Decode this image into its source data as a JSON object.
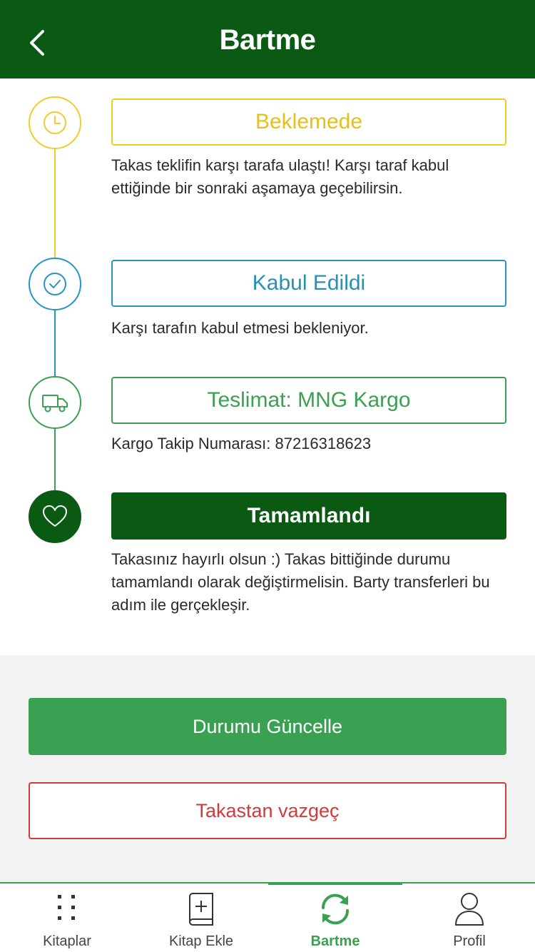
{
  "header": {
    "title": "Bartme"
  },
  "steps": [
    {
      "label": "Beklemede",
      "description": "Takas teklifin karşı tarafa ulaştı! Karşı taraf kabul ettiğinde bir sonraki aşamaya geçebilirsin.",
      "icon": "clock-icon",
      "color": "#f0cc2c"
    },
    {
      "label": "Kabul Edildi",
      "description": "Karşı tarafın kabul etmesi bekleniyor.",
      "icon": "check-circle-icon",
      "color": "#2596be"
    },
    {
      "label": "Teslimat: MNG Kargo",
      "description": "Kargo Takip Numarası: 87216318623",
      "icon": "truck-icon",
      "color": "#3aa052"
    },
    {
      "label": "Tamamlandı",
      "description": "Takasınız hayırlı olsun :) Takas bittiğinde durumu tamamlandı olarak değiştirmelisin. Barty transferleri bu adım ile gerçekleşir.",
      "icon": "heart-icon",
      "color": "#0b5a13"
    }
  ],
  "actions": {
    "update_label": "Durumu Güncelle",
    "cancel_label": "Takastan vazgeç"
  },
  "tabs": [
    {
      "label": "Kitaplar",
      "icon": "grid-icon"
    },
    {
      "label": "Kitap Ekle",
      "icon": "add-book-icon"
    },
    {
      "label": "Bartme",
      "icon": "exchange-icon",
      "active": true
    },
    {
      "label": "Profil",
      "icon": "profile-icon"
    }
  ],
  "colors": {
    "header": "#0b5a13",
    "accent": "#3aa052",
    "danger": "#d33a3a",
    "pending": "#f0cc2c",
    "accepted": "#2596be"
  }
}
